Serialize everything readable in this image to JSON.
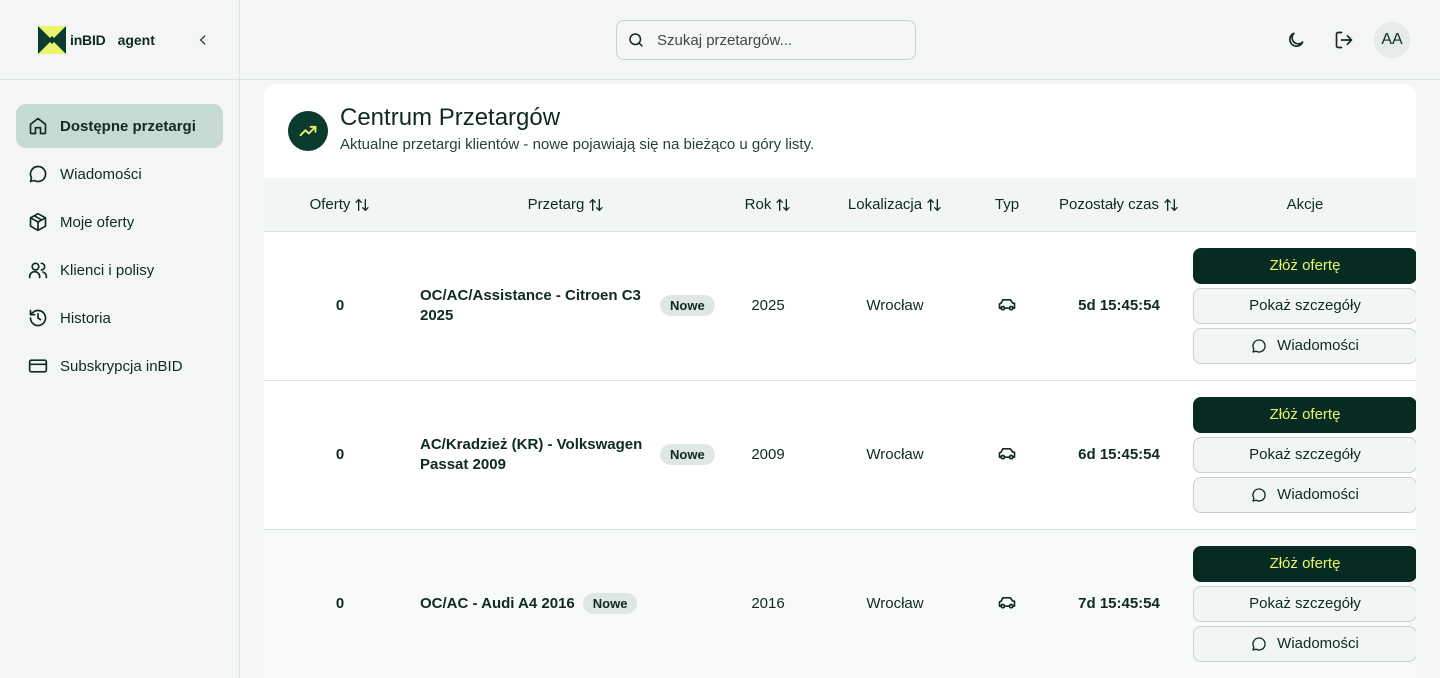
{
  "brand": {
    "logo_text": "inBID",
    "role": "agent"
  },
  "sidebar": {
    "items": [
      {
        "label": "Dostępne przetargi",
        "icon": "home-icon",
        "active": true
      },
      {
        "label": "Wiadomości",
        "icon": "chat-bubble-icon",
        "active": false
      },
      {
        "label": "Moje oferty",
        "icon": "package-icon",
        "active": false
      },
      {
        "label": "Klienci i polisy",
        "icon": "users-icon",
        "active": false
      },
      {
        "label": "Historia",
        "icon": "history-icon",
        "active": false
      },
      {
        "label": "Subskrypcja inBID",
        "icon": "credit-card-icon",
        "active": false
      }
    ]
  },
  "header": {
    "search_placeholder": "Szukaj przetargów...",
    "avatar_initials": "AA"
  },
  "main": {
    "title": "Centrum Przetargów",
    "subtitle": "Aktualne przetargi klientów - nowe pojawiają się na bieżąco u góry listy.",
    "columns": [
      "Oferty",
      "Przetarg",
      "Rok",
      "Lokalizacja",
      "Typ",
      "Pozostały czas",
      "Akcje"
    ],
    "rows": [
      {
        "offers": "0",
        "tender": "OC/AC/Assistance - Citroen C3 2025",
        "badge": "Nowe",
        "year": "2025",
        "location": "Wrocław",
        "type_icon": "car-icon",
        "time_left": "5d 15:45:54"
      },
      {
        "offers": "0",
        "tender": "AC/Kradzież (KR) - Volkswagen Passat 2009",
        "badge": "Nowe",
        "year": "2009",
        "location": "Wrocław",
        "type_icon": "car-icon",
        "time_left": "6d 15:45:54"
      },
      {
        "offers": "0",
        "tender": "OC/AC - Audi A4 2016",
        "badge": "Nowe",
        "year": "2016",
        "location": "Wrocław",
        "type_icon": "car-icon",
        "time_left": "7d 15:45:54"
      }
    ],
    "actions": {
      "offer_label": "Złóż ofertę",
      "details_label": "Pokaż szczegóły",
      "messages_label": "Wiadomości"
    }
  },
  "colors": {
    "primary": "#062b22",
    "accent_text": "#e8f46a",
    "active_nav": "#c6dad5",
    "logo_yellow": "#e8f46a"
  }
}
